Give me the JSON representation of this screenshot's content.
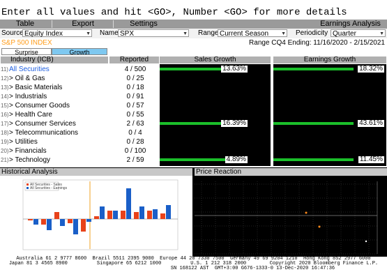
{
  "command_line": "Enter all values and hit <GO>, Number <GO> for more details",
  "tabs": {
    "table": "Table",
    "export": "Export",
    "settings": "Settings",
    "title": "Earnings Analysis"
  },
  "params": {
    "source_label": "Source",
    "source_value": "Equity Index",
    "name_label": "Name",
    "name_value": "SPX",
    "range_label": "Range",
    "range_value": "Current Season",
    "periodicity_label": "Periodicity",
    "periodicity_value": "Quarter"
  },
  "info": {
    "index_name": "S&P 500 INDEX",
    "range_text": "Range CQ4 Ending: 11/16/2020 - 2/15/2021"
  },
  "subtabs": {
    "surprise": "Surprise",
    "growth": "Growth"
  },
  "table": {
    "headers": {
      "industry": "Industry (ICB)",
      "reported": "Reported",
      "sales": "Sales Growth",
      "earnings": "Earnings Growth"
    },
    "rows": [
      {
        "num": "11)",
        "name": "All Securities",
        "reported": "4 / 500",
        "sales": "13.63%",
        "sales_value": 13.63,
        "earnings": "18.32%",
        "earnings_value": 18.32
      },
      {
        "num": "12)",
        "name": "> Oil & Gas",
        "reported": "0 / 25",
        "sales": "",
        "earnings": ""
      },
      {
        "num": "13)",
        "name": "> Basic Materials",
        "reported": "0 / 18",
        "sales": "",
        "earnings": ""
      },
      {
        "num": "14)",
        "name": "> Industrials",
        "reported": "0 / 91",
        "sales": "",
        "earnings": ""
      },
      {
        "num": "15)",
        "name": "> Consumer Goods",
        "reported": "0 / 57",
        "sales": "",
        "earnings": ""
      },
      {
        "num": "16)",
        "name": "> Health Care",
        "reported": "0 / 55",
        "sales": "",
        "earnings": ""
      },
      {
        "num": "17)",
        "name": "> Consumer Services",
        "reported": "2 / 63",
        "sales": "16.39%",
        "sales_value": 16.39,
        "earnings": "43.61%",
        "earnings_value": 43.61
      },
      {
        "num": "18)",
        "name": "> Telecommunications",
        "reported": "0 / 4",
        "sales": "",
        "earnings": ""
      },
      {
        "num": "19)",
        "name": "> Utilities",
        "reported": "0 / 28",
        "sales": "",
        "earnings": ""
      },
      {
        "num": "20)",
        "name": "> Financials",
        "reported": "0 / 100",
        "sales": "",
        "earnings": ""
      },
      {
        "num": "21)",
        "name": "> Technology",
        "reported": "2 / 59",
        "sales": "4.89%",
        "sales_value": 4.89,
        "earnings": "11.45%",
        "earnings_value": 11.45
      }
    ]
  },
  "historical": {
    "title": "Historical Analysis",
    "legend": [
      "All Securities - Sales",
      "All Securities - Earnings"
    ],
    "colors": {
      "sales": "#e8421a",
      "earnings": "#1a5fc8",
      "marker": "#f0a020"
    },
    "sales_values": [
      -1,
      -4,
      5,
      -3,
      -9,
      2,
      6,
      6,
      5,
      6,
      4
    ],
    "earnings_values": [
      -4,
      -8,
      -5,
      -11,
      -2,
      9,
      6,
      22,
      9,
      7,
      10
    ]
  },
  "price": {
    "title": "Price Reaction"
  },
  "footer": {
    "line1": "Australia 61 2 9777 8600  Brazil 5511 2395 9000  Europe 44 20 7330 7500  Germany 49 69 9204 1210  Hong Kong 852 2977 6000",
    "line2": "Japan 81 3 4565 8900          Singapore 65 6212 1000          U.S. 1 212 318 2000        Copyright 2020 Bloomberg Finance L.P.",
    "line3": "SN 168122 AST  GMT+3:00 G676-1333-0 13-Dec-2020 16:47:36"
  }
}
